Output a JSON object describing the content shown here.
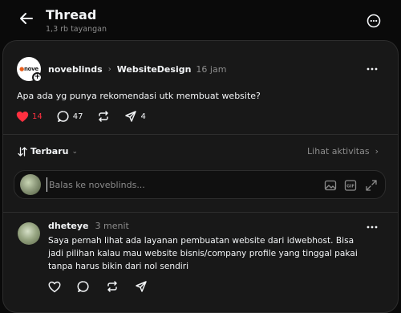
{
  "header": {
    "title": "Thread",
    "views": "1,3 rb tayangan"
  },
  "post": {
    "username": "noveblinds",
    "topic": "WebsiteDesign",
    "time": "16 jam",
    "avatar_text": "nove",
    "text": "Apa ada yg punya rekomendasi utk membuat website?",
    "likes": "14",
    "replies": "47",
    "shares": "4",
    "liked": true
  },
  "sort": {
    "label": "Terbaru",
    "activity_link": "Lihat aktivitas"
  },
  "reply": {
    "placeholder": "Balas ke noveblinds..."
  },
  "comments": [
    {
      "username": "dheteye",
      "time": "3 menit",
      "text": "Saya pernah lihat ada layanan pembuatan website dari idwebhost. Bisa jadi pilihan kalau mau website bisnis/company profile yang tinggal pakai tanpa harus bikin dari nol sendiri"
    }
  ],
  "colors": {
    "background": "#0a0a0a",
    "card": "#181818",
    "like_red": "#ff3040",
    "muted": "#8c8c8c"
  },
  "icons": [
    "back-arrow-icon",
    "more-circle-icon",
    "heart-icon",
    "comment-icon",
    "repost-icon",
    "share-icon",
    "sort-icon",
    "image-icon",
    "gif-icon",
    "expand-icon"
  ]
}
